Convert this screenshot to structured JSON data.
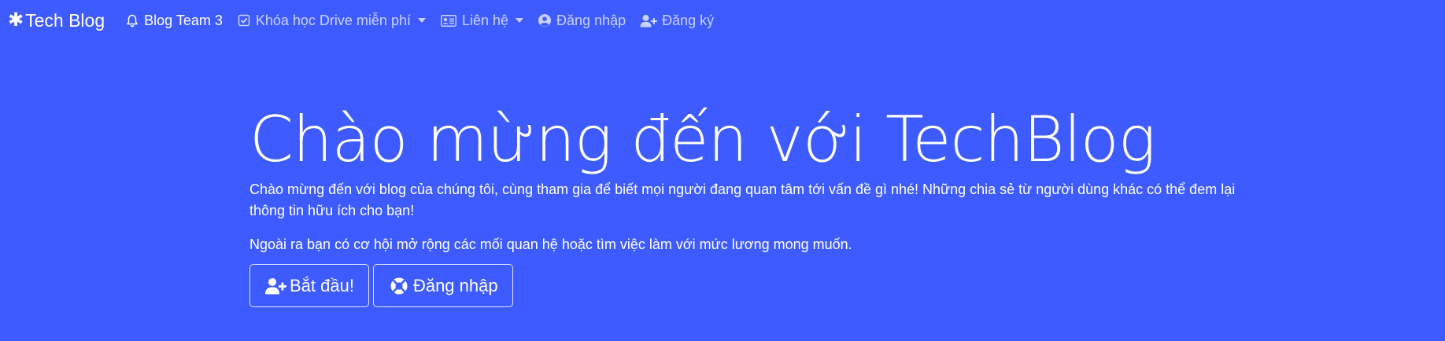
{
  "navbar": {
    "brand": {
      "icon": "asterisk-icon",
      "label": "Tech Blog"
    },
    "items": [
      {
        "icon": "bell-icon",
        "label": "Blog Team 3",
        "active": true,
        "dropdown": false
      },
      {
        "icon": "check-square-icon",
        "label": "Khóa học Drive miễn phí",
        "active": false,
        "dropdown": true
      },
      {
        "icon": "address-card-icon",
        "label": "Liên hệ",
        "active": false,
        "dropdown": true
      },
      {
        "icon": "user-circle-icon",
        "label": "Đăng nhập",
        "active": false,
        "dropdown": false
      },
      {
        "icon": "user-plus-icon",
        "label": "Đăng ký",
        "active": false,
        "dropdown": false
      }
    ]
  },
  "hero": {
    "title": "Chào mừng đến với TechBlog",
    "lead": "Chào mừng đến với blog của chúng tôi, cùng tham gia để biết mọi người đang quan tâm tới vấn đề gì nhé! Những chia sẻ từ người dùng khác có thể đem lại thông tin hữu ích cho bạn!",
    "sub": "Ngoài ra bạn có cơ hội mở rộng các mối quan hệ hoặc tìm việc làm với mức lương mong muốn.",
    "buttons": {
      "start": {
        "icon": "user-plus-icon",
        "label": "Bắt đầu!"
      },
      "login": {
        "icon": "life-ring-icon",
        "label": "Đăng nhập"
      }
    }
  },
  "colors": {
    "background": "#3e5bff",
    "text": "#ffffff",
    "muted_nav": "rgba(255,255,255,0.72)"
  }
}
